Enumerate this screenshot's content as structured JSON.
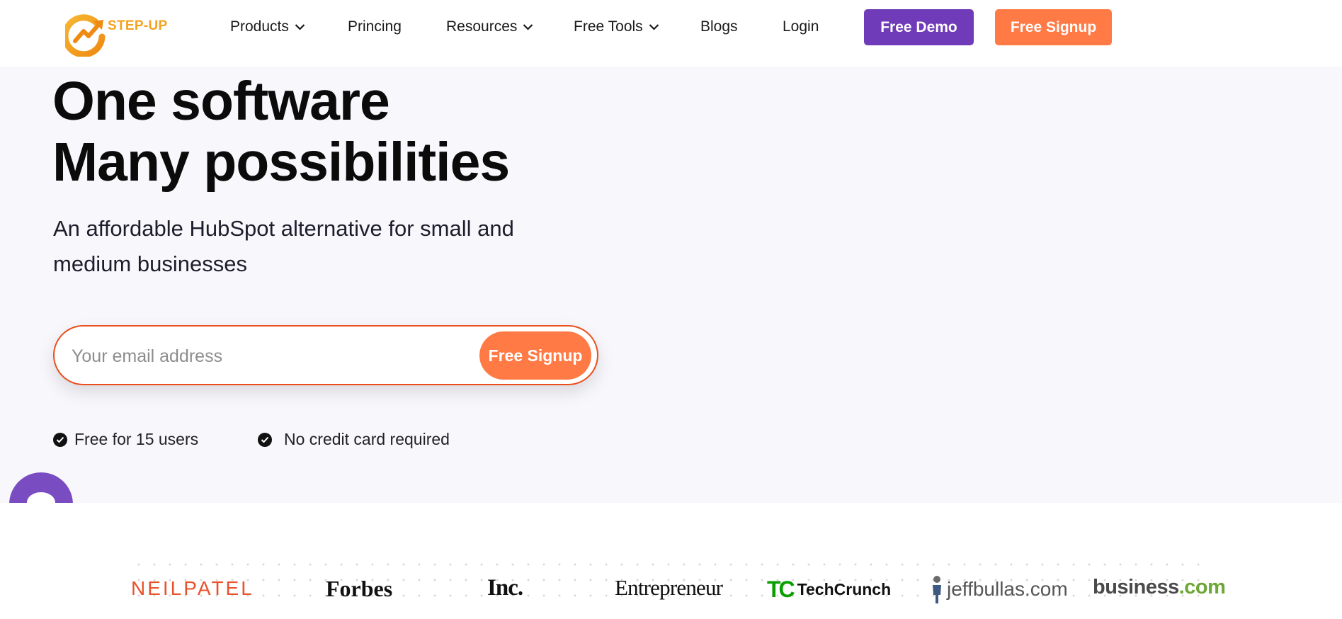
{
  "brand": {
    "name": "STEP-UP",
    "color": "#f5a21d"
  },
  "nav": {
    "items": [
      {
        "label": "Products",
        "dropdown": true
      },
      {
        "label": "Princing",
        "dropdown": false
      },
      {
        "label": "Resources",
        "dropdown": true
      },
      {
        "label": "Free Tools",
        "dropdown": true
      },
      {
        "label": "Blogs",
        "dropdown": false
      },
      {
        "label": "Login",
        "dropdown": false
      }
    ],
    "demo_label": "Free Demo",
    "signup_label": "Free Signup"
  },
  "hero": {
    "headline_line1": "One software",
    "headline_line2": "Many possibilities",
    "subhead": "An affordable HubSpot alternative for small and medium businesses",
    "email_placeholder": "Your email address",
    "email_value": "",
    "signup_label": "Free Signup",
    "checks": [
      "Free for 15 users",
      "No credit card required"
    ]
  },
  "press": {
    "neilpatel": "NEILPATEL",
    "forbes": "Forbes",
    "inc": "Inc.",
    "entrepreneur": "Entrepreneur",
    "techcrunch": "TechCrunch",
    "techcrunch_mark": "TC",
    "jeffbullas": "jeffbullas.com",
    "business": "business",
    "business_suffix": ".com"
  },
  "icons": {
    "chevron": "chevron-down-icon",
    "check": "check-circle-icon",
    "chat": "chat-bubble-icon"
  },
  "colors": {
    "accent_purple": "#6f3bb8",
    "accent_orange": "#ff7a45",
    "form_border": "#ea4f1c",
    "hero_bg": "#f8f7fc"
  }
}
